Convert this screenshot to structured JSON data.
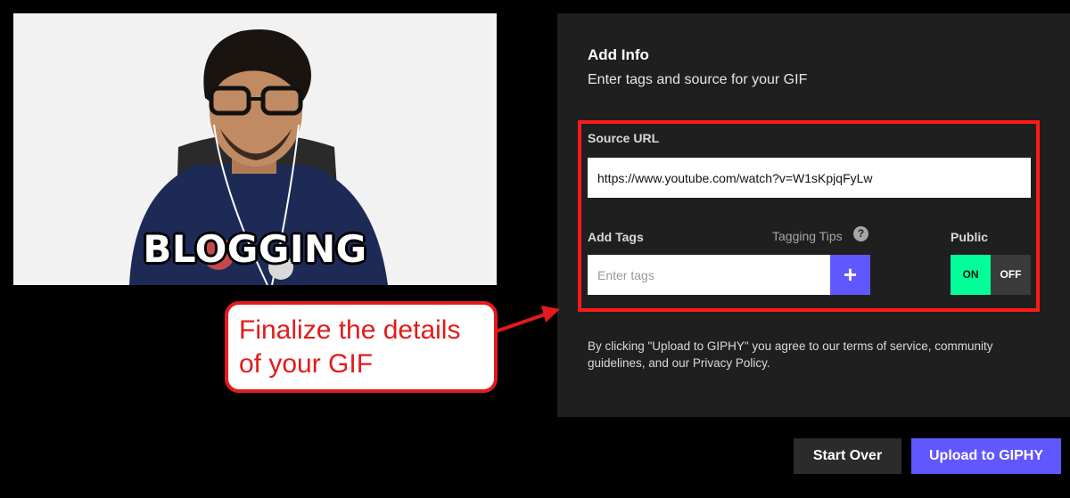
{
  "preview": {
    "caption": "BLOGGING"
  },
  "panel": {
    "title": "Add Info",
    "subtitle": "Enter tags and source for your GIF",
    "source_url": {
      "label": "Source URL",
      "value": "https://www.youtube.com/watch?v=W1sKpjqFyLw"
    },
    "tags": {
      "label": "Add Tags",
      "placeholder": "Enter tags",
      "add_button": "+",
      "tips_label": "Tagging Tips",
      "help_icon": "?"
    },
    "visibility": {
      "label": "Public",
      "on_label": "ON",
      "off_label": "OFF",
      "selected": "ON"
    },
    "terms": "By clicking \"Upload to GIPHY\" you agree to our terms of service, community guidelines, and our Privacy Policy."
  },
  "annotation": {
    "callout_line1": "Finalize the details",
    "callout_line2": "of your GIF",
    "color": "#e31b1b"
  },
  "actions": {
    "start_over": "Start Over",
    "upload": "Upload to GIPHY"
  },
  "colors": {
    "accent": "#6157ff",
    "toggle_on": "#00ff99",
    "panel_bg": "#1f1f1f"
  }
}
